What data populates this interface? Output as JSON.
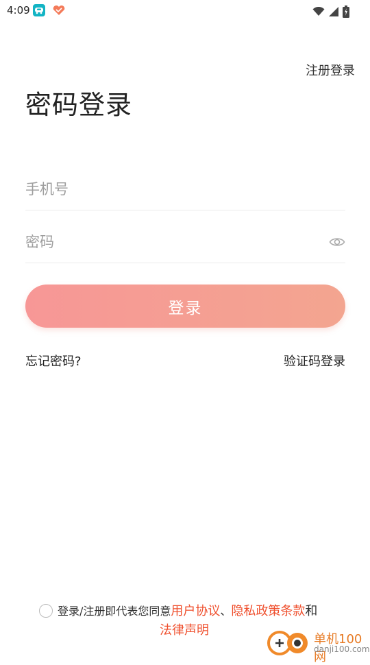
{
  "status_bar": {
    "time": "4:09"
  },
  "header": {
    "register_link": "注册登录",
    "title": "密码登录"
  },
  "form": {
    "phone_placeholder": "手机号",
    "password_placeholder": "密码",
    "login_button": "登录",
    "forgot_password": "忘记密码?",
    "sms_login": "验证码登录"
  },
  "agreement": {
    "prefix": "登录/注册即代表您同意",
    "user_agreement": "用户协议",
    "separator": "、",
    "privacy_policy": "隐私政策条款",
    "and": "和",
    "legal_statement": "法律声明",
    "accent_color": "#ef4f2d"
  },
  "watermark": {
    "site_name": "单机100网",
    "site_url": "danji100.com"
  },
  "icons": {
    "status": [
      "app-icon",
      "heart-icon",
      "wifi-icon",
      "signal-icon",
      "battery-icon"
    ],
    "password_visibility": "eye-icon"
  },
  "colors": {
    "button_gradient_start": "#f79796",
    "button_gradient_end": "#f3a590"
  }
}
